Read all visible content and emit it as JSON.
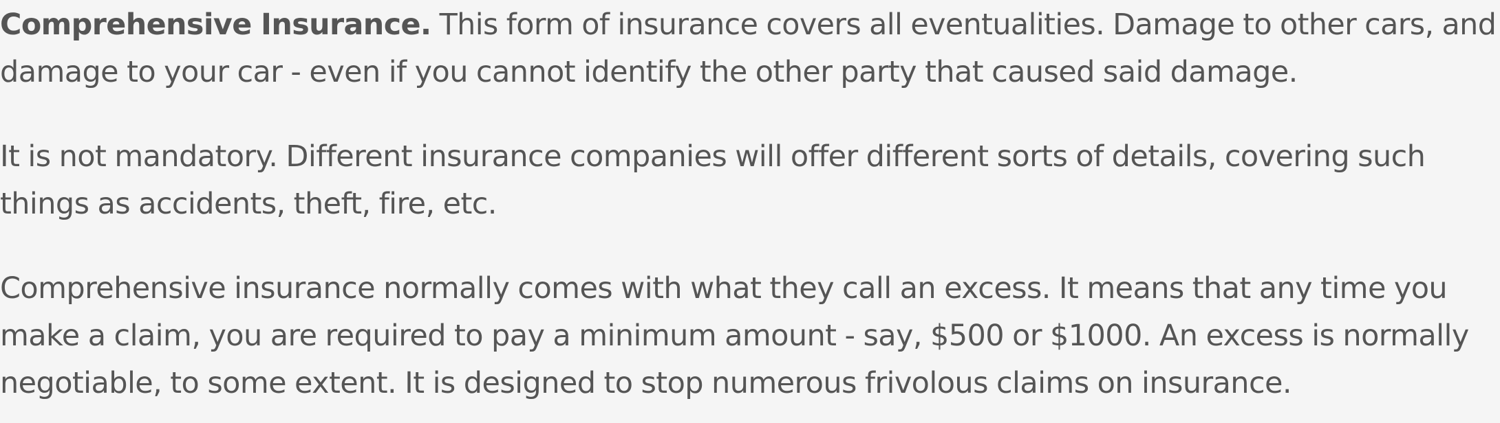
{
  "article": {
    "paragraphs": [
      {
        "lead": "Comprehensive Insurance.",
        "lines": [
          " This form of insurance covers all eventualities. Damage to other cars, and",
          "damage to your car - even if you cannot identify the other party that caused said damage."
        ]
      },
      {
        "lines": [
          "It is not mandatory. Different insurance companies will offer different sorts of details, covering such",
          "things as accidents, theft, fire, etc."
        ]
      },
      {
        "lines": [
          "Comprehensive insurance normally comes with what they call an excess. It means that any time you",
          "make a claim, you are required to pay a minimum amount - say, $500 or $1000. An excess is normally",
          "negotiable, to some extent. It is designed to stop numerous frivolous claims on insurance."
        ]
      }
    ]
  }
}
